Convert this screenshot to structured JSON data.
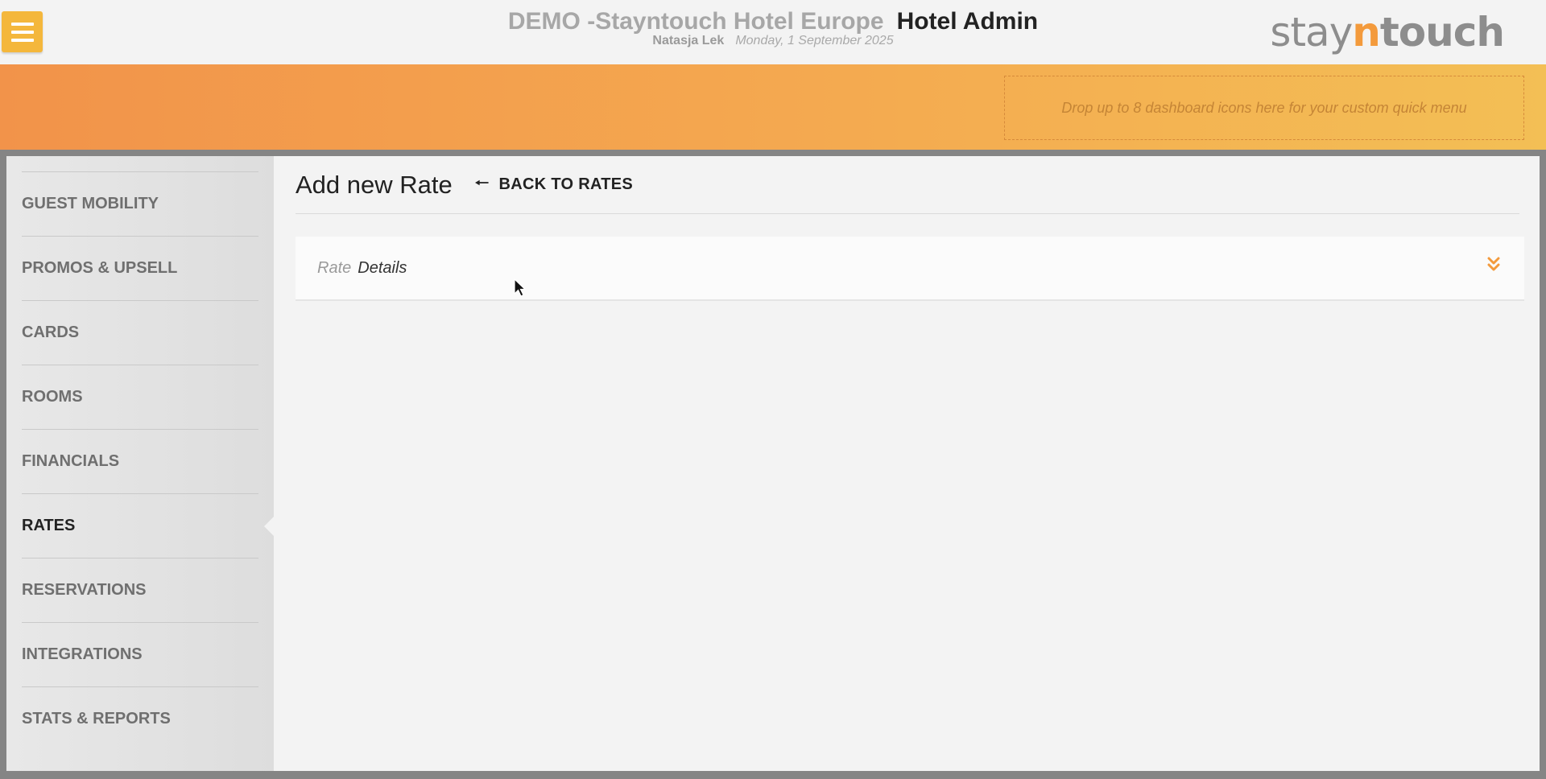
{
  "header": {
    "hotel_name": "DEMO -Stayntouch Hotel Europe",
    "app_name": "Hotel Admin",
    "user_name": "Natasja Lek",
    "date": "Monday, 1 September 2025",
    "logo": {
      "part1": "stay",
      "part2": "n",
      "part3": "touch"
    }
  },
  "quick_menu": {
    "placeholder": "Drop up to 8 dashboard icons here for your custom quick menu"
  },
  "sidebar": {
    "items": [
      {
        "label": "GUEST MOBILITY",
        "active": false
      },
      {
        "label": "PROMOS & UPSELL",
        "active": false
      },
      {
        "label": "CARDS",
        "active": false
      },
      {
        "label": "ROOMS",
        "active": false
      },
      {
        "label": "FINANCIALS",
        "active": false
      },
      {
        "label": "RATES",
        "active": true
      },
      {
        "label": "RESERVATIONS",
        "active": false
      },
      {
        "label": "INTEGRATIONS",
        "active": false
      },
      {
        "label": "STATS & REPORTS",
        "active": false
      }
    ]
  },
  "main": {
    "title": "Add new Rate",
    "back_label": "BACK TO RATES",
    "accordion": {
      "label_muted": "Rate",
      "label_strong": "Details"
    }
  },
  "colors": {
    "accent": "#f4b73c",
    "banner_start": "#f2934a",
    "banner_end": "#f3bf55",
    "chevron": "#f39a3c"
  },
  "icons": {
    "menu": "hamburger-icon",
    "back": "arrow-left-icon",
    "expand": "double-chevron-down-icon",
    "cursor": "mouse-pointer-icon"
  }
}
